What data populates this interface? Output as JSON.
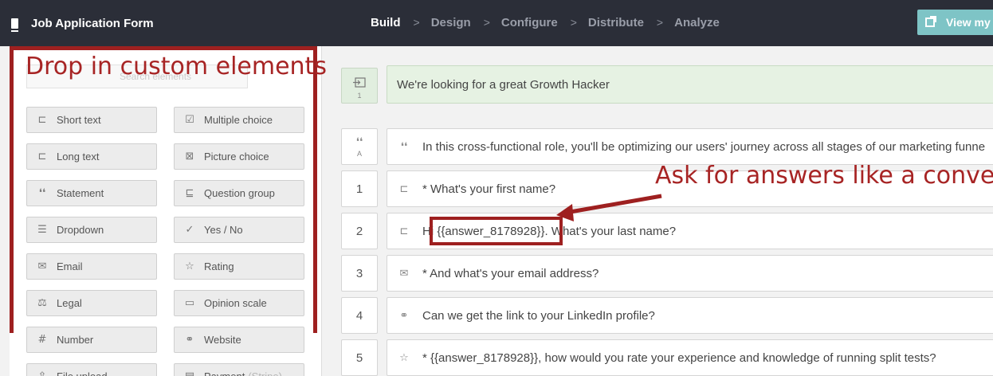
{
  "topbar": {
    "title": "Job Application Form",
    "steps": [
      "Build",
      "Design",
      "Configure",
      "Distribute",
      "Analyze"
    ],
    "separator": ">",
    "view_button": "View my"
  },
  "left": {
    "search_placeholder": "Search elements",
    "elements": [
      {
        "label": "Short text",
        "icon": "short-text-icon",
        "glyph": "⊏"
      },
      {
        "label": "Multiple choice",
        "icon": "checkbox-icon",
        "glyph": "☑"
      },
      {
        "label": "Long text",
        "icon": "long-text-icon",
        "glyph": "⊏"
      },
      {
        "label": "Picture choice",
        "icon": "picture-choice-icon",
        "glyph": "⊠"
      },
      {
        "label": "Statement",
        "icon": "quote-icon",
        "glyph": "❛❛"
      },
      {
        "label": "Question group",
        "icon": "question-group-icon",
        "glyph": "⊑"
      },
      {
        "label": "Dropdown",
        "icon": "dropdown-icon",
        "glyph": "☰"
      },
      {
        "label": "Yes / No",
        "icon": "yes-no-icon",
        "glyph": "✓"
      },
      {
        "label": "Email",
        "icon": "email-icon",
        "glyph": "✉"
      },
      {
        "label": "Rating",
        "icon": "star-icon",
        "glyph": "☆"
      },
      {
        "label": "Legal",
        "icon": "scales-icon",
        "glyph": "⚖"
      },
      {
        "label": "Opinion scale",
        "icon": "opinion-scale-icon",
        "glyph": "▭"
      },
      {
        "label": "Number",
        "icon": "hash-icon",
        "glyph": "#"
      },
      {
        "label": "Website",
        "icon": "link-icon",
        "glyph": "⚭"
      },
      {
        "label": "File upload",
        "icon": "file-upload-icon",
        "glyph": "⇪"
      },
      {
        "label": "Payment",
        "extra": "(Stripe)",
        "icon": "payment-icon",
        "glyph": "▤"
      }
    ]
  },
  "annotations": {
    "left": "Drop in custom elements",
    "right": "Ask for answers like a conversa"
  },
  "questions": {
    "welcome": "We're looking for a great Growth Hacker",
    "welcome_num": "1",
    "statement_letter": "A",
    "statement": "In this cross-functional role, you'll be optimizing our users' journey across all stages of our marketing funne",
    "items": [
      {
        "num": "1",
        "icon": "short-text-icon",
        "glyph": "⊏",
        "text": "* What's your first name?"
      },
      {
        "num": "2",
        "icon": "short-text-icon",
        "glyph": "⊏",
        "text": "Hi {{answer_8178928}}. What's your last name?"
      },
      {
        "num": "3",
        "icon": "email-icon",
        "glyph": "✉",
        "text": "* And what's your email address?"
      },
      {
        "num": "4",
        "icon": "link-icon",
        "glyph": "⚭",
        "text": "Can we get the link to your LinkedIn profile?"
      },
      {
        "num": "5",
        "icon": "star-icon",
        "glyph": "☆",
        "text": "* {{answer_8178928}}, how would you rate your experience and knowledge of running split tests?"
      }
    ]
  },
  "colors": {
    "accent_red": "#9e2020",
    "topbar": "#2b2e38",
    "view_button": "#7ec4c6"
  }
}
